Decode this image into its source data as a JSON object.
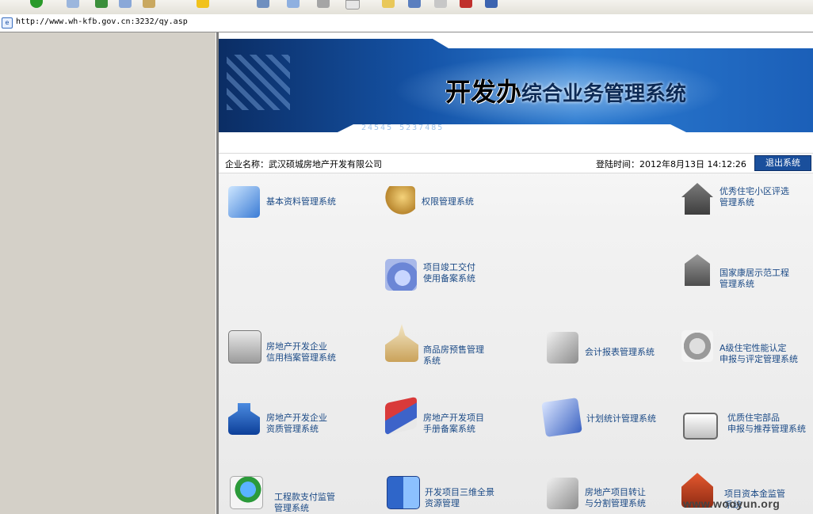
{
  "browser": {
    "address_url": "http://www.wh-kfb.gov.cn:3232/qy.asp"
  },
  "banner": {
    "title_big": "开发办",
    "title_rest": "综合业务管理系统",
    "code_text": "24545 5237485"
  },
  "infobar": {
    "company": "企业名称：武汉硕城房地产开发有限公司",
    "login_time": "登陆时间：2012年8月13日 14:12:26",
    "logout_label": "退出系统"
  },
  "modules": [
    {
      "icon": "computer-display-icon",
      "line1": "基本资料管理系统",
      "line2": ""
    },
    {
      "icon": "users-icon",
      "line1": "权限管理系统",
      "line2": ""
    },
    {
      "icon": "house-icon",
      "line1": "优秀住宅小区评选",
      "line2": "管理系统"
    },
    {
      "icon": "folder-disc-icon",
      "line1": "项目竣工交付",
      "line2": "使用备案系统"
    },
    {
      "icon": "building-icon",
      "line1": "国家康居示范工程",
      "line2": "管理系统"
    },
    {
      "icon": "computer-icon",
      "line1": "房地产开发企业",
      "line2": "信用档案管理系统"
    },
    {
      "icon": "church-icon",
      "line1": "商品房预售管理",
      "line2": "系统"
    },
    {
      "icon": "apple-folder-icon",
      "line1": "会计报表管理系统",
      "line2": ""
    },
    {
      "icon": "download-icon",
      "line1": "A级住宅性能认定",
      "line2": "申报与评定管理系统"
    },
    {
      "icon": "office-building-icon",
      "line1": "房地产开发企业",
      "line2": "资质管理系统"
    },
    {
      "icon": "books-icon",
      "line1": "房地产开发项目",
      "line2": "手册备案系统"
    },
    {
      "icon": "apple-card-icon",
      "line1": "计划统计管理系统",
      "line2": ""
    },
    {
      "icon": "photo-icon",
      "line1": "优质住宅部品",
      "line2": "申报与推荐管理系统"
    },
    {
      "icon": "payment-icon",
      "line1": "工程款支付监管",
      "line2": "管理系统"
    },
    {
      "icon": "finder-icon",
      "line1": "开发项目三维全景",
      "line2": "资源管理"
    },
    {
      "icon": "apple-folder-icon",
      "line1": "房地产项目转让",
      "line2": "与分割管理系统"
    },
    {
      "icon": "house-fund-icon",
      "line1": "项目资本金监管",
      "line2": "系统"
    }
  ],
  "watermark": "www.wooyun.org",
  "colors": {
    "banner_dark": "#0b2d64",
    "banner_light": "#2b7ad0",
    "link_text": "#1b4a86",
    "logout_bg": "#1a4f9c"
  }
}
